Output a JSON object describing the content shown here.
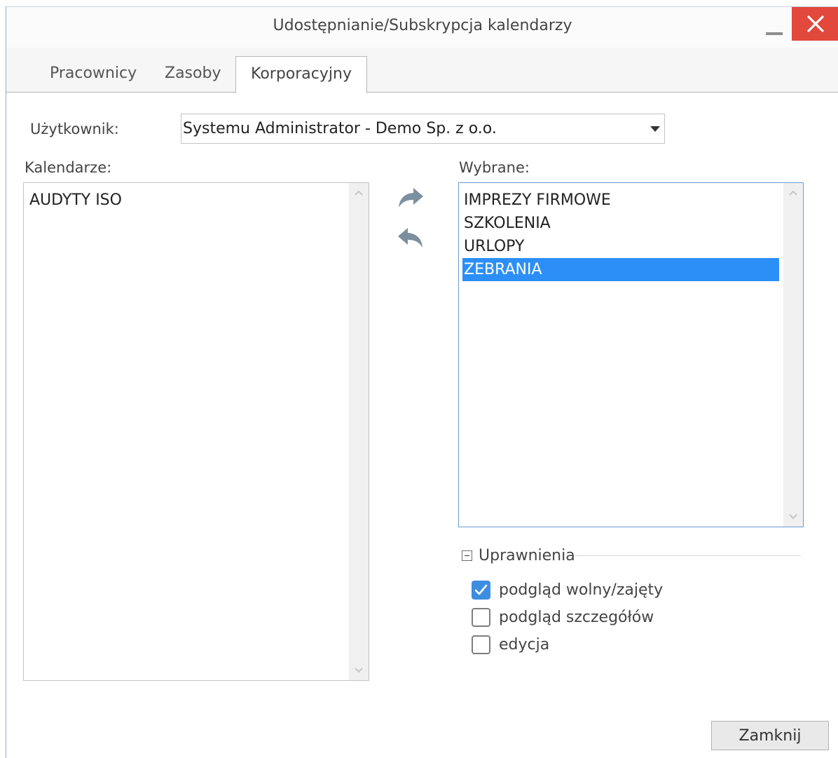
{
  "window": {
    "title": "Udostępnianie/Subskrypcja kalendarzy"
  },
  "tabs": [
    {
      "label": "Pracownicy",
      "active": false
    },
    {
      "label": "Zasoby",
      "active": false
    },
    {
      "label": "Korporacyjny",
      "active": true
    }
  ],
  "user": {
    "label": "Użytkownik:",
    "selected": "Systemu Administrator - Demo Sp. z o.o."
  },
  "calendars": {
    "label": "Kalendarze:",
    "items": [
      "AUDYTY ISO"
    ]
  },
  "selected_list": {
    "label": "Wybrane:",
    "items": [
      "IMPREZY FIRMOWE",
      "SZKOLENIA",
      "URLOPY",
      "ZEBRANIA"
    ],
    "selected_index": 3
  },
  "permissions": {
    "legend": "Uprawnienia",
    "options": [
      {
        "label": "podgląd wolny/zajęty",
        "checked": true
      },
      {
        "label": "podgląd szczegółów",
        "checked": false
      },
      {
        "label": "edycja",
        "checked": false
      }
    ]
  },
  "footer": {
    "close_label": "Zamknij"
  },
  "colors": {
    "accent": "#2b8ff7",
    "close_button": "#e2483b",
    "checkbox_checked": "#3d8ee0"
  }
}
